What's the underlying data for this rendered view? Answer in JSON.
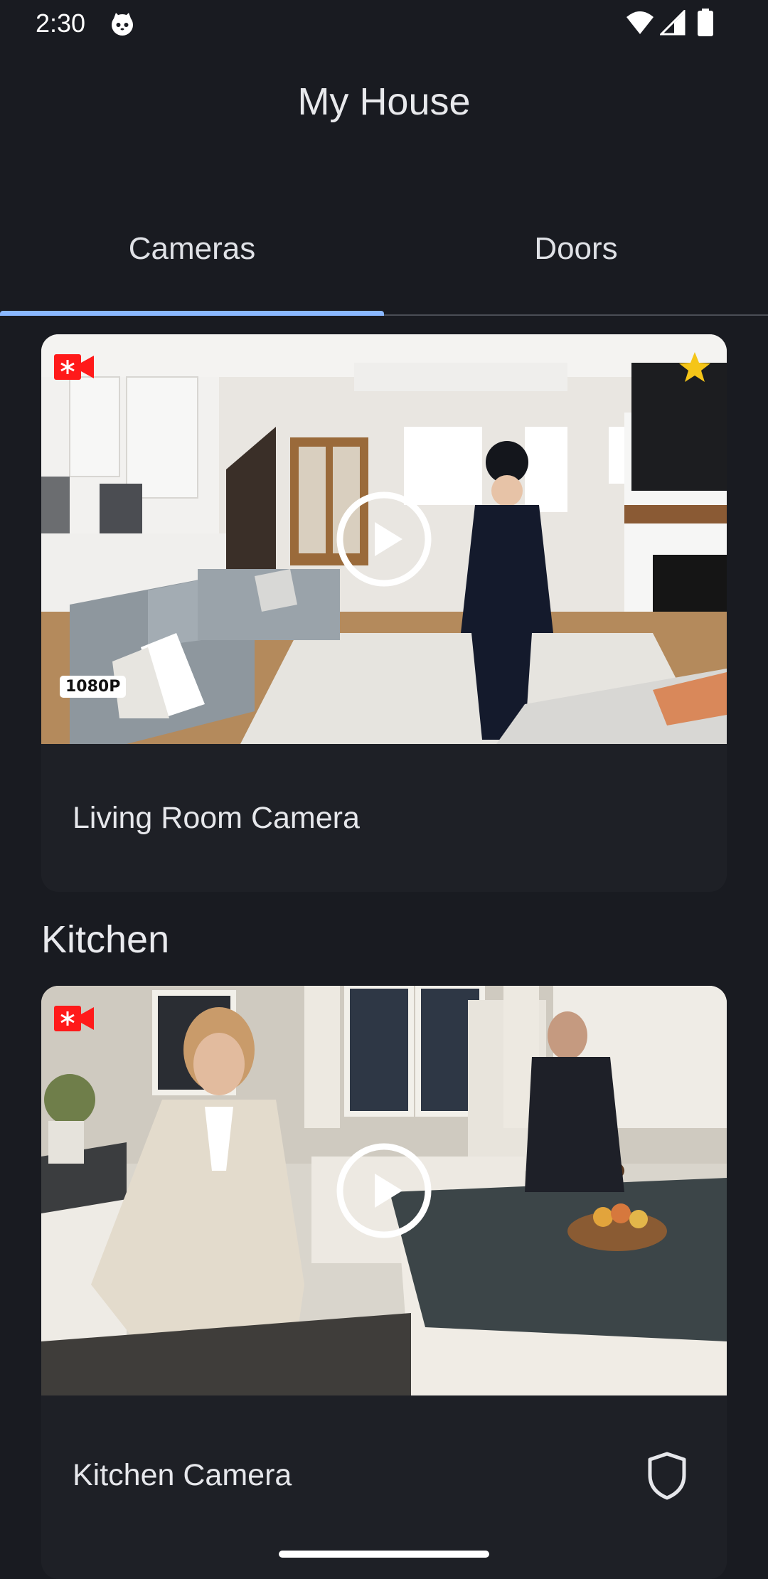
{
  "status_bar": {
    "time": "2:30",
    "notification_icon": "cat-icon",
    "icons": [
      "wifi-icon",
      "signal-icon",
      "battery-icon"
    ]
  },
  "app_bar": {
    "title": "My House"
  },
  "tabs": [
    {
      "label": "Cameras",
      "selected": true
    },
    {
      "label": "Doors",
      "selected": false
    }
  ],
  "colors": {
    "background": "#191b21",
    "card": "#1e2026",
    "tab_indicator": "#8ab8ff",
    "recording": "#ff1a1a",
    "favorite_star": "#f5c518"
  },
  "cameras": [
    {
      "name": "Living Room Camera",
      "resolution_badge": "1080P",
      "recording_icon": "video-record-icon",
      "favorite": true,
      "play_icon": "play-circle-icon"
    },
    {
      "section": "Kitchen",
      "name": "Kitchen Camera",
      "recording_icon": "video-record-icon",
      "play_icon": "play-circle-icon",
      "action_icon": "shield-icon"
    }
  ]
}
